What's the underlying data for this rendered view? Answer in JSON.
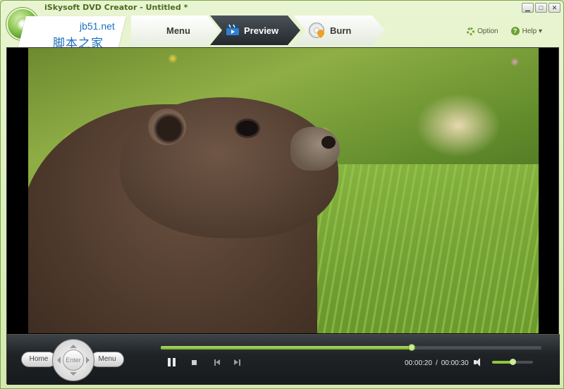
{
  "window": {
    "title": "iSkysoft DVD Creator - Untitled *",
    "controls": {
      "minimize": "▁",
      "maximize": "□",
      "close": "✕"
    }
  },
  "watermark": {
    "line1": "jb51.net",
    "line2": "脚本之家"
  },
  "steps": [
    {
      "label": "Menu",
      "icon": "menu-icon"
    },
    {
      "label": "Preview",
      "icon": "clapperboard-icon",
      "active": true
    },
    {
      "label": "Burn",
      "icon": "disc-burn-icon"
    }
  ],
  "topbar": {
    "option_label": "Option",
    "help_label": "Help ▾"
  },
  "player": {
    "home_label": "Home",
    "enter_label": "Enter",
    "menu_label": "Menu",
    "current_time": "00:00:20",
    "total_time": "00:00:30",
    "time_separator": "/",
    "progress": 0.66,
    "volume": 0.5
  },
  "colors": {
    "accent": "#6fae28",
    "frame": "#d3e9ae",
    "active_tab": "#24292d"
  }
}
